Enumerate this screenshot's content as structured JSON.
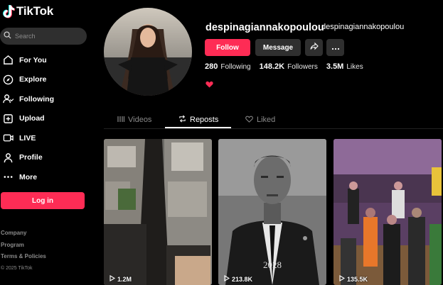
{
  "brand": {
    "name": "TikTok",
    "accent": "#fe2c55"
  },
  "search": {
    "placeholder": "Search"
  },
  "nav": [
    {
      "label": "For You",
      "icon": "home-icon"
    },
    {
      "label": "Explore",
      "icon": "compass-icon"
    },
    {
      "label": "Following",
      "icon": "following-icon"
    },
    {
      "label": "Upload",
      "icon": "upload-icon"
    },
    {
      "label": "LIVE",
      "icon": "live-icon"
    },
    {
      "label": "Profile",
      "icon": "profile-icon"
    },
    {
      "label": "More",
      "icon": "more-icon"
    }
  ],
  "login_label": "Log in",
  "footer": {
    "links": [
      "Company",
      "Program",
      "Terms & Policies"
    ],
    "copyright": "© 2025 TikTok"
  },
  "profile": {
    "username": "despinagiannakopoulou",
    "nickname": "despinagiannakopoulou",
    "follow_label": "Follow",
    "message_label": "Message",
    "stats": {
      "following_count": "280",
      "following_label": "Following",
      "followers_count": "148.2K",
      "followers_label": "Followers",
      "likes_count": "3.5M",
      "likes_label": "Likes"
    }
  },
  "tabs": [
    {
      "label": "Videos",
      "active": false
    },
    {
      "label": "Reposts",
      "active": true
    },
    {
      "label": "Liked",
      "active": false
    }
  ],
  "videos": [
    {
      "views": "1.2M"
    },
    {
      "views": "213.8K",
      "caption_year": "2028"
    },
    {
      "views": "135.5K"
    }
  ]
}
